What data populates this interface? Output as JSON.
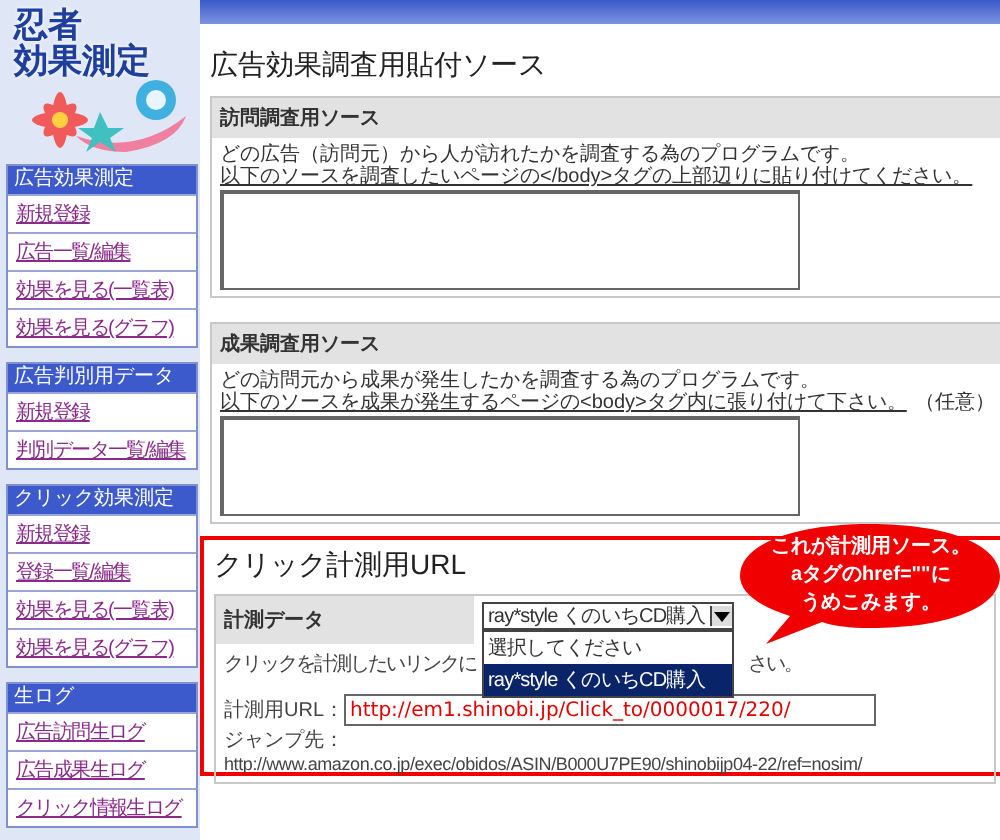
{
  "logo": {
    "line_1": "忍者",
    "line_2": "効果測定"
  },
  "sidebar": {
    "sections": [
      {
        "title": "広告効果測定",
        "items": [
          "新規登録",
          "広告一覧/編集",
          "効果を見る(一覧表)",
          "効果を見る(グラフ)"
        ]
      },
      {
        "title": "広告判別用データ",
        "items": [
          "新規登録",
          "判別データ一覧/編集"
        ]
      },
      {
        "title": "クリック効果測定",
        "items": [
          "新規登録",
          "登録一覧/編集",
          "効果を見る(一覧表)",
          "効果を見る(グラフ)"
        ]
      },
      {
        "title": "生ログ",
        "items": [
          "広告訪問生ログ",
          "広告成果生ログ",
          "クリック情報生ログ"
        ]
      }
    ]
  },
  "page_title": "広告効果調査用貼付ソース",
  "panels": [
    {
      "title": "訪問調査用ソース",
      "line_1": "どの広告（訪問元）から人が訪れたかを調査する為のプログラムです。",
      "line_2": "以下のソースを調査したいページの</body>タグの上部辺りに貼り付けてください。"
    },
    {
      "title": "成果調査用ソース",
      "line_1": "どの訪問元から成果が発生したかを調査する為のプログラムです。",
      "line_2": "以下のソースを成果が発生するページの<body>タグ内に張り付けて下さい。",
      "note": "（任意）"
    }
  ],
  "click_section": {
    "title": "クリック計測用URL",
    "data_label": "計測データ",
    "select": {
      "value": "ray*style くのいちCD購入",
      "options": [
        {
          "label": "選択してください",
          "selected": false
        },
        {
          "label": "ray*style くのいちCD購入",
          "selected": true
        }
      ]
    },
    "instruction_start": "クリックを計測したいリンクに",
    "instruction_end": "さい。",
    "url_label": "計測用URL：",
    "url_value": "http://em1.shinobi.jp/Click_to/0000017/220/",
    "jump_label": "ジャンプ先：",
    "jump_url": "http://www.amazon.co.jp/exec/obidos/ASIN/B000U7PE90/shinobijp04-22/ref=nosim/"
  },
  "callout": {
    "lines": [
      "これが計測用ソース。",
      "aタグのhref=\"\"に",
      "うめこみます。"
    ]
  }
}
